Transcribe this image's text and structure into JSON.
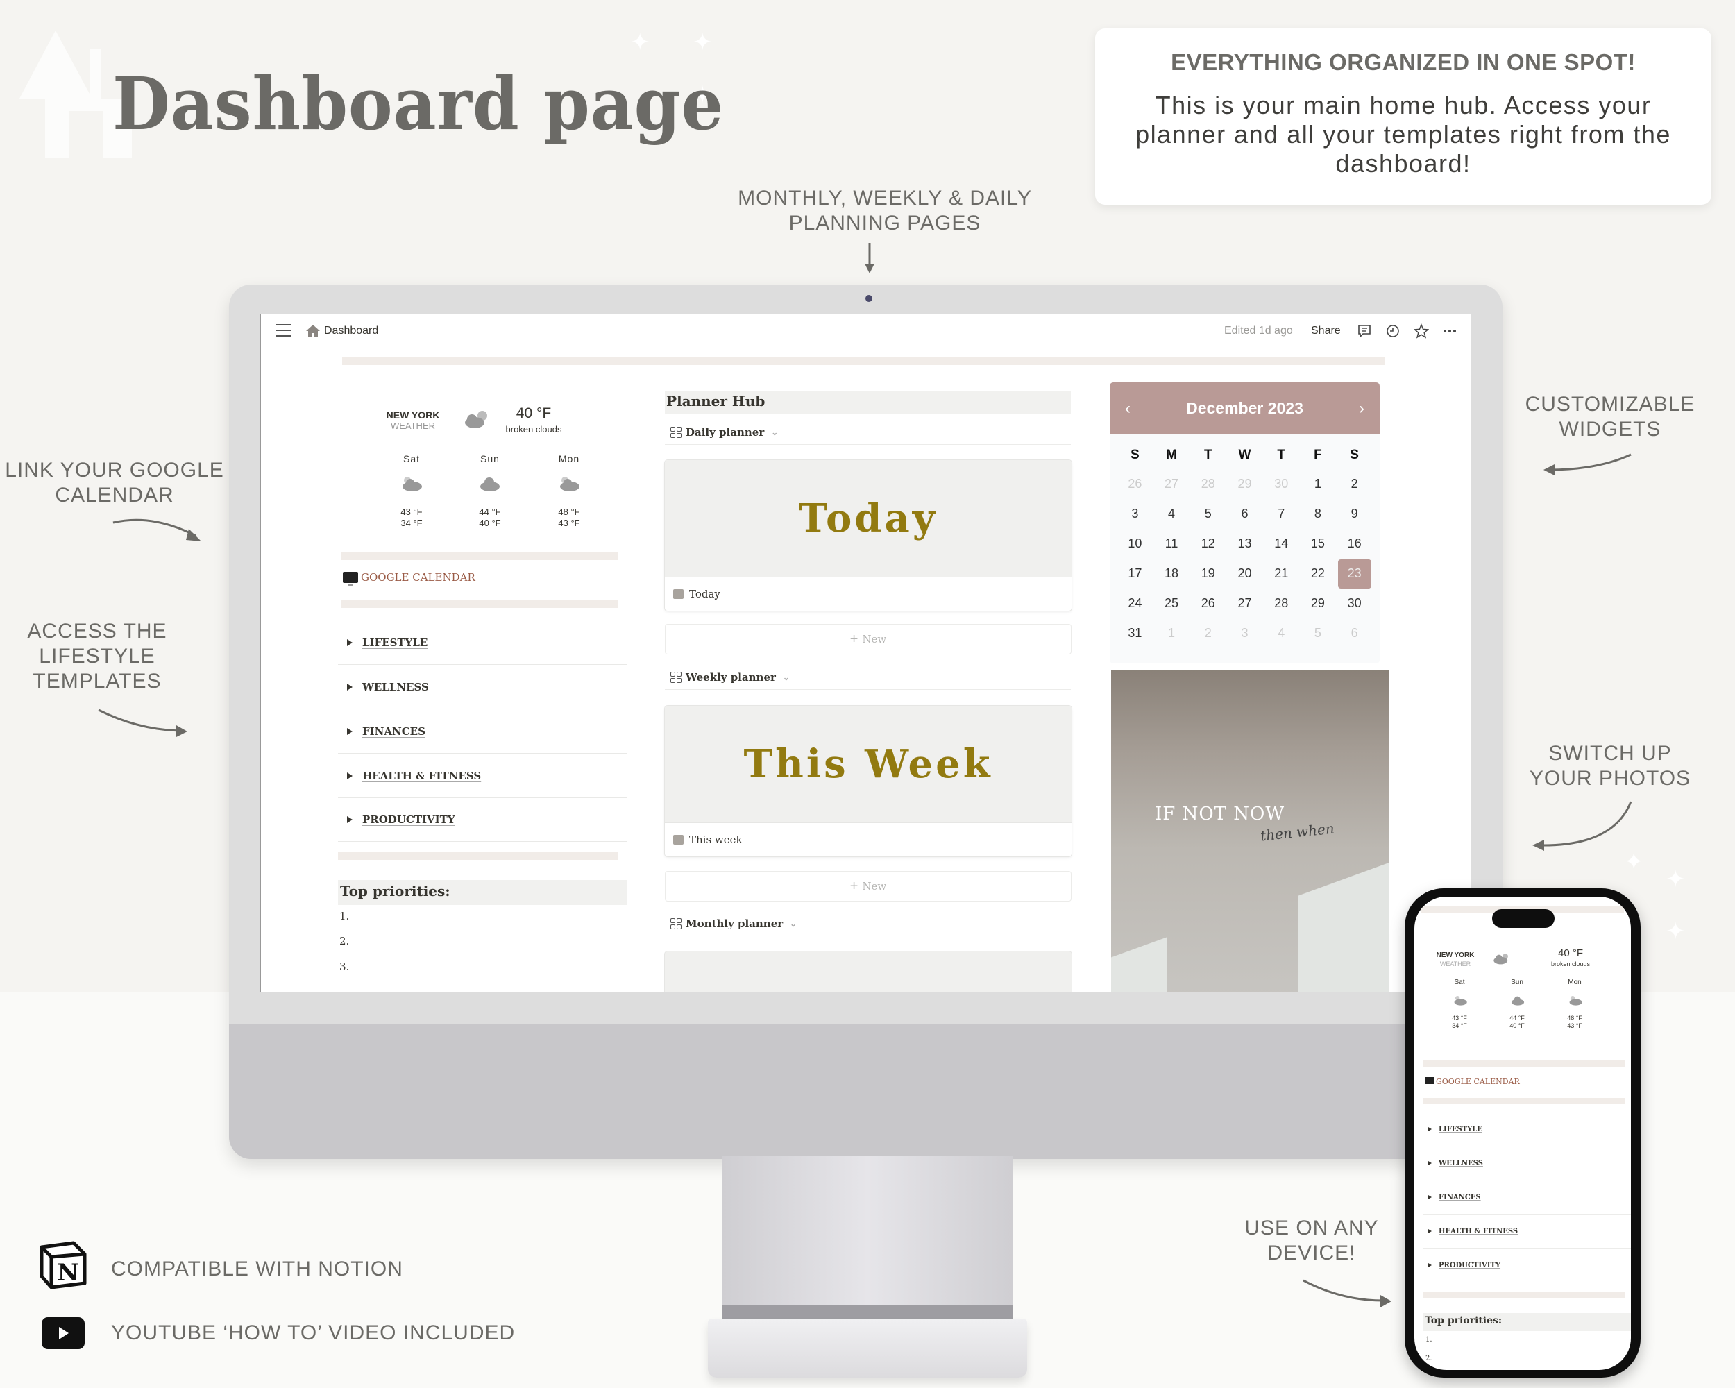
{
  "hero": {
    "title": "Dashboard page"
  },
  "info_card": {
    "heading": "EVERYTHING ORGANIZED IN ONE SPOT!",
    "body": "This is your main home hub. Access your planner and all your templates right from the dashboard!"
  },
  "annotations": {
    "planning_pages": "MONTHLY, WEEKLY & DAILY PLANNING PAGES",
    "google_calendar": "LINK YOUR GOOGLE CALENDAR",
    "lifestyle_templates": "ACCESS THE LIFESTYLE TEMPLATES",
    "widgets": "CUSTOMIZABLE WIDGETS",
    "photos": "SWITCH UP YOUR PHOTOS",
    "any_device": "USE ON ANY DEVICE!"
  },
  "features": [
    {
      "icon": "notion-logo-icon",
      "label": "COMPATIBLE WITH NOTION"
    },
    {
      "icon": "youtube-play-icon",
      "label": "YOUTUBE ‘HOW TO’ VIDEO INCLUDED"
    }
  ],
  "app": {
    "topbar": {
      "breadcrumb": "Dashboard",
      "edited": "Edited 1d ago",
      "share": "Share",
      "icons": [
        "menu-icon",
        "home-icon",
        "comment-icon",
        "history-clock-icon",
        "star-icon",
        "more-icon"
      ]
    },
    "weather": {
      "city": "NEW YORK",
      "subtitle": "WEATHER",
      "current_temp": "40 °F",
      "condition": "broken clouds",
      "forecast": [
        {
          "day": "Sat",
          "high": "43 °F",
          "low": "34 °F"
        },
        {
          "day": "Sun",
          "high": "44 °F",
          "low": "40 °F"
        },
        {
          "day": "Mon",
          "high": "48 °F",
          "low": "43 °F"
        }
      ]
    },
    "google_calendar_link": "GOOGLE CALENDAR",
    "toggles": [
      "LIFESTYLE",
      "WELLNESS",
      "FINANCES",
      "HEALTH & FITNESS",
      "PRODUCTIVITY"
    ],
    "priorities": {
      "heading": "Top priorities:",
      "items": [
        "1.",
        "2.",
        "3."
      ]
    },
    "planner_hub": {
      "title": "Planner Hub",
      "views": [
        {
          "name": "Daily planner",
          "card_cover": "Today",
          "card_title": "Today"
        },
        {
          "name": "Weekly planner",
          "card_cover": "This Week",
          "card_title": "This week"
        },
        {
          "name": "Monthly planner"
        }
      ],
      "new_label": "New"
    },
    "calendar": {
      "title": "December 2023",
      "prev": "‹",
      "next": "›",
      "weekdays": [
        "S",
        "M",
        "T",
        "W",
        "T",
        "F",
        "S"
      ],
      "days": [
        {
          "n": "26",
          "muted": true
        },
        {
          "n": "27",
          "muted": true
        },
        {
          "n": "28",
          "muted": true
        },
        {
          "n": "29",
          "muted": true
        },
        {
          "n": "30",
          "muted": true
        },
        {
          "n": "1"
        },
        {
          "n": "2"
        },
        {
          "n": "3"
        },
        {
          "n": "4"
        },
        {
          "n": "5"
        },
        {
          "n": "6"
        },
        {
          "n": "7"
        },
        {
          "n": "8"
        },
        {
          "n": "9"
        },
        {
          "n": "10"
        },
        {
          "n": "11"
        },
        {
          "n": "12"
        },
        {
          "n": "13"
        },
        {
          "n": "14"
        },
        {
          "n": "15"
        },
        {
          "n": "16"
        },
        {
          "n": "17"
        },
        {
          "n": "18"
        },
        {
          "n": "19"
        },
        {
          "n": "20"
        },
        {
          "n": "21"
        },
        {
          "n": "22"
        },
        {
          "n": "23",
          "selected": true
        },
        {
          "n": "24"
        },
        {
          "n": "25"
        },
        {
          "n": "26"
        },
        {
          "n": "27"
        },
        {
          "n": "28"
        },
        {
          "n": "29"
        },
        {
          "n": "30"
        },
        {
          "n": "31"
        },
        {
          "n": "1",
          "muted": true
        },
        {
          "n": "2",
          "muted": true
        },
        {
          "n": "3",
          "muted": true
        },
        {
          "n": "4",
          "muted": true
        },
        {
          "n": "5",
          "muted": true
        },
        {
          "n": "6",
          "muted": true
        }
      ],
      "accent_color": "#b99a96"
    },
    "photo_quote": {
      "line1": "IF NOT NOW",
      "line2": "then when"
    }
  },
  "colors": {
    "background": "#f5f4f1",
    "text_gray": "#6b6a66",
    "gold": "#927a10",
    "rose": "#b99a96",
    "link_brown": "#9a5b46"
  }
}
